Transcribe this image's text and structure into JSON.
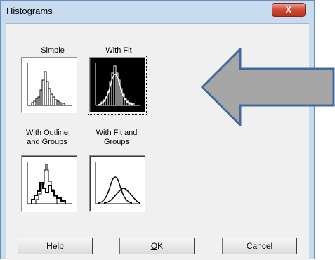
{
  "window": {
    "title": "Histograms",
    "close_glyph": "X"
  },
  "options": [
    {
      "label": "Simple",
      "graph": "simple-histogram"
    },
    {
      "label": "With Fit",
      "graph": "histogram-with-fit",
      "selected": true
    },
    {
      "label_line1": "With Outline",
      "label_line2": "and Groups",
      "graph": "outline-grouped-histogram"
    },
    {
      "label_line1": "With Fit and",
      "label_line2": "Groups",
      "graph": "grouped-fit-curves"
    }
  ],
  "buttons": {
    "help": "Help",
    "ok_underline": "O",
    "ok_rest": "K",
    "cancel": "Cancel"
  },
  "annotation": {
    "arrow_color": "#a6a6a6",
    "arrow_outline": "#44689c",
    "direction": "left"
  }
}
